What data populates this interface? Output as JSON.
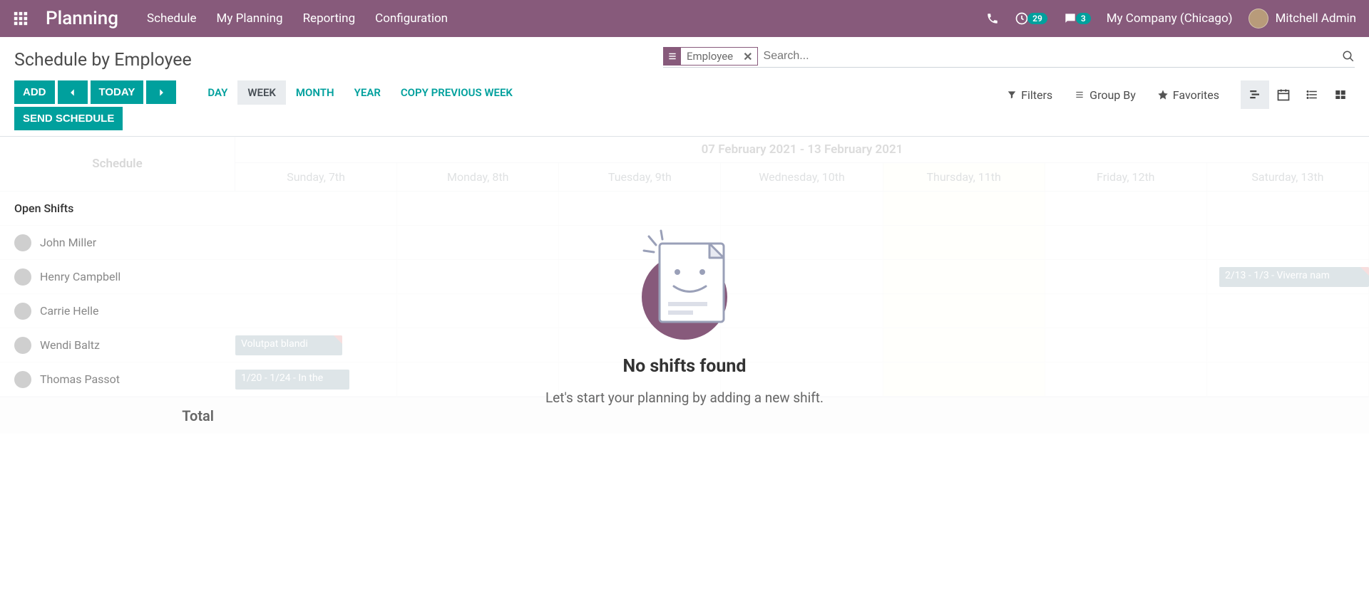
{
  "navbar": {
    "brand": "Planning",
    "menu": [
      "Schedule",
      "My Planning",
      "Reporting",
      "Configuration"
    ],
    "activity_count": "29",
    "msg_count": "3",
    "company": "My Company (Chicago)",
    "user": "Mitchell Admin"
  },
  "cp": {
    "title": "Schedule by Employee",
    "search_facet": "Employee",
    "search_placeholder": "Search...",
    "add": "ADD",
    "today": "TODAY",
    "send": "SEND SCHEDULE",
    "ranges": [
      "DAY",
      "WEEK",
      "MONTH",
      "YEAR",
      "COPY PREVIOUS WEEK"
    ],
    "active_range": "WEEK",
    "filters": "Filters",
    "groupby": "Group By",
    "favorites": "Favorites"
  },
  "schedule": {
    "corner": "Schedule",
    "title": "07 February 2021 - 13 February 2021",
    "days": [
      "Sunday, 7th",
      "Monday, 8th",
      "Tuesday, 9th",
      "Wednesday, 10th",
      "Thursday, 11th",
      "Friday, 12th",
      "Saturday, 13th"
    ],
    "highlight_index": 4,
    "open_shifts": "Open Shifts",
    "employees": [
      "John Miller",
      "Henry Campbell",
      "Carrie Helle",
      "Wendi Baltz",
      "Thomas Passot"
    ],
    "total": "Total",
    "shifts": {
      "henry_sat": "2/13 - 1/3 - Viverra nam",
      "wendi_sun": "Volutpat blandi",
      "thomas_sun": "1/20 - 1/24 - In the"
    }
  },
  "empty": {
    "title": "No shifts found",
    "subtitle": "Let's start your planning by adding a new shift."
  }
}
